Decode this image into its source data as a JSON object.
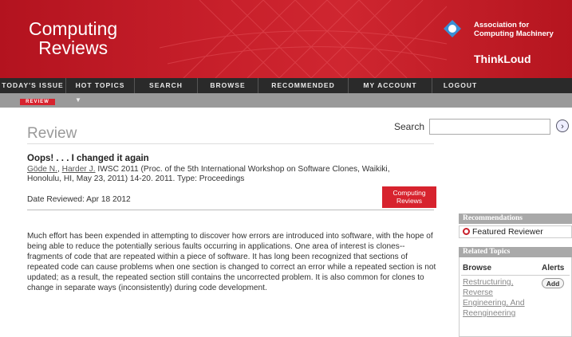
{
  "header": {
    "logo_line1": "Computing",
    "logo_line2": "Reviews",
    "acm_line1": "Association for",
    "acm_line2": "Computing Machinery",
    "thinkloud": "ThinkLoud"
  },
  "nav": {
    "items": [
      "TODAY'S ISSUE",
      "HOT TOPICS",
      "SEARCH",
      "BROWSE",
      "RECOMMENDED",
      "MY ACCOUNT",
      "LOGOUT"
    ]
  },
  "subnav": {
    "review_tab": "REVIEW",
    "arrow": "▼"
  },
  "page": {
    "title": "Review"
  },
  "search": {
    "label": "Search",
    "value": "",
    "go": "›"
  },
  "article": {
    "title": "Oops! . . . I changed it again",
    "author1": "Göde N.",
    "author_sep": ", ",
    "author2": "Harder J.",
    "citation": "  IWSC 2011 (Proc. of the 5th International Workshop on Software Clones, Waikiki, Honolulu, HI,  May 23, 2011) 14-20. 2011. Type: Proceedings",
    "date": "Date Reviewed: Apr 18 2012",
    "badge_line1": "Computing",
    "badge_line2": "Reviews",
    "body": "Much effort has been expended in attempting to discover how errors are introduced into software, with the hope of being able to reduce the potentially serious faults occurring in applications. One area of interest is clones--fragments of code that are repeated within a piece of software. It has long been recognized that sections of repeated code can cause problems when one section is changed to correct an error while a repeated section is not updated; as a result, the repeated section still contains the uncorrected problem. It is also common for clones to change in separate ways (inconsistently) during code development."
  },
  "sidebar": {
    "recommendations": "Recommendations",
    "featured": "Featured Reviewer",
    "related": "Related Topics",
    "browse": "Browse",
    "alerts": "Alerts",
    "topic": "Restructuring, Reverse Engineering, And Reengineering",
    "add": "Add"
  }
}
